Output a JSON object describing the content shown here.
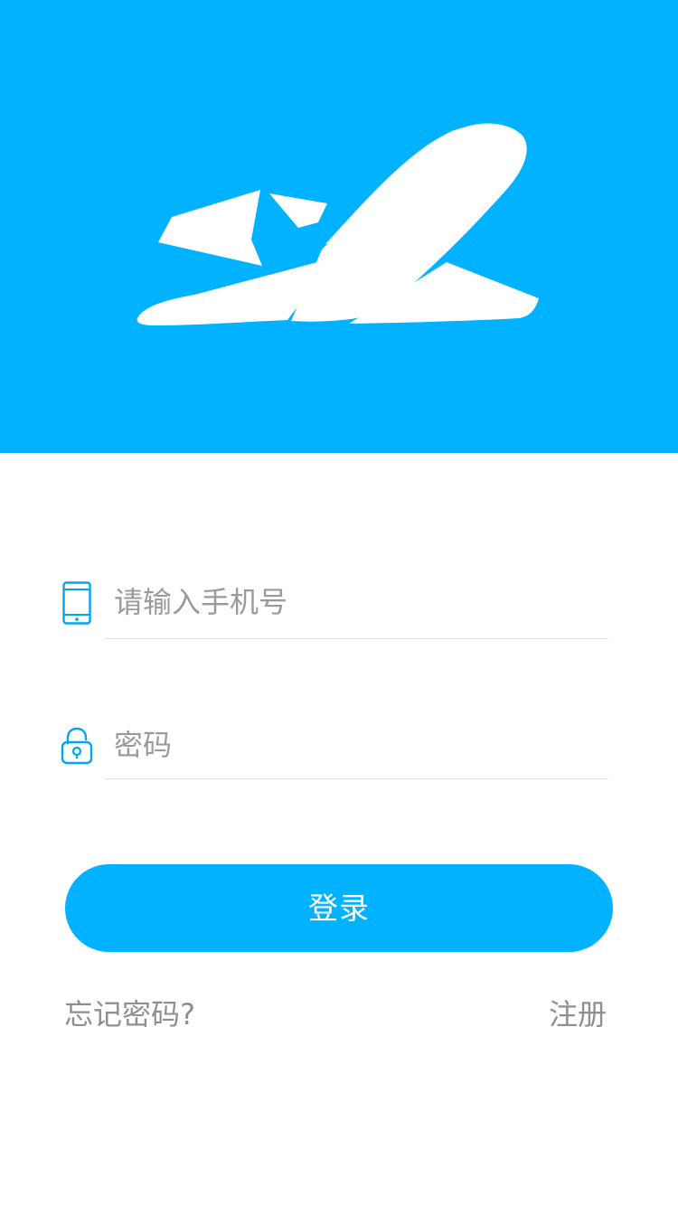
{
  "header": {
    "background_color": "#00b2ff",
    "logo_icon": "airplane-takeoff-icon"
  },
  "phone": {
    "icon": "phone-icon",
    "placeholder": "请输入手机号",
    "value": ""
  },
  "password": {
    "icon": "lock-icon",
    "placeholder": "密码",
    "value": ""
  },
  "login": {
    "label": "登录",
    "color": "#00b2ff"
  },
  "links": {
    "forgot_password": "忘记密码?",
    "register": "注册"
  }
}
